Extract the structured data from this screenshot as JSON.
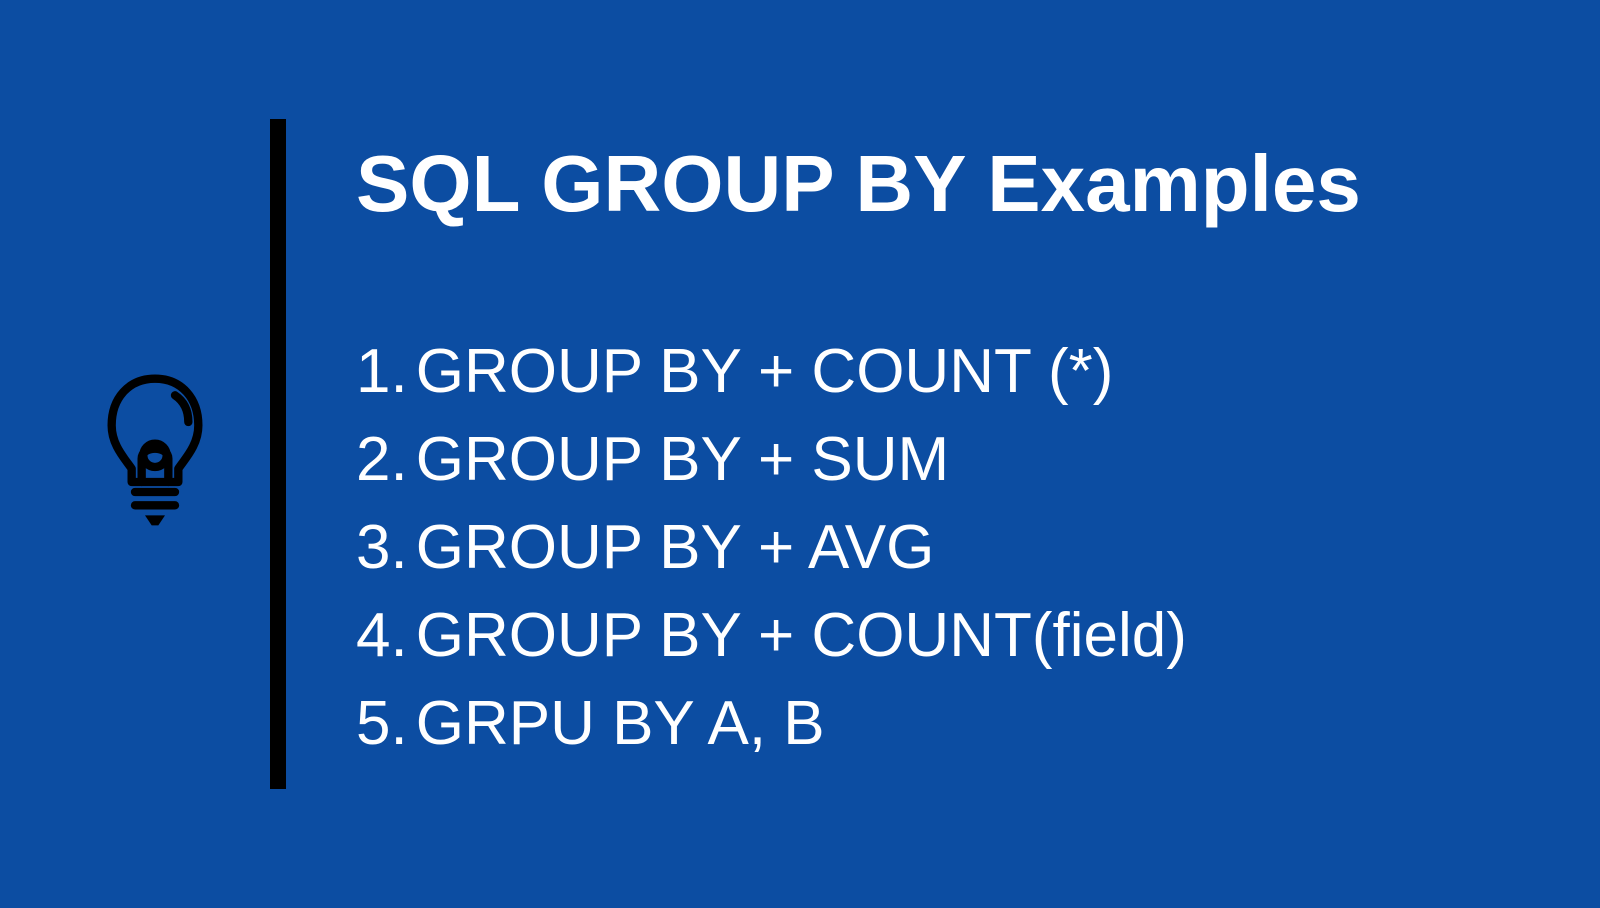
{
  "title": "SQL GROUP BY  Examples",
  "items": [
    {
      "num": "1.",
      "text": "GROUP BY + COUNT (*)"
    },
    {
      "num": "2.",
      "text": "GROUP BY + SUM"
    },
    {
      "num": "3.",
      "text": "GROUP BY + AVG"
    },
    {
      "num": "4.",
      "text": "GROUP BY + COUNT(field)"
    },
    {
      "num": "5.",
      "text": "GRPU BY A, B"
    }
  ]
}
